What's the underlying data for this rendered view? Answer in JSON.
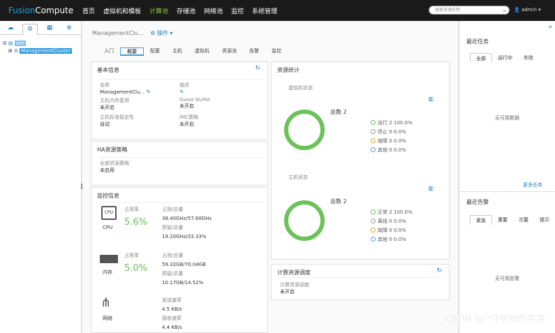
{
  "header": {
    "brand_prefix": "Fusion",
    "brand_suffix": "Compute",
    "nav": [
      "首页",
      "虚拟机和模板",
      "计算池",
      "存储池",
      "网络池",
      "监控",
      "系统管理"
    ],
    "active_nav_index": 2,
    "search_placeholder": "搜索资源名称",
    "user": "admin"
  },
  "left": {
    "tree": [
      {
        "label": "site",
        "level": 0
      },
      {
        "label": "ManagementCluster",
        "level": 1,
        "selected": true
      }
    ]
  },
  "main": {
    "breadcrumb": "ManagementClu...",
    "operation": "操作",
    "tabs": [
      "入门",
      "概要",
      "配置",
      "主机",
      "虚拟机",
      "资源池",
      "告警",
      "监控"
    ],
    "active_tab_index": 1,
    "basic": {
      "title": "基本信息",
      "fields": [
        {
          "k": "名称",
          "v": "ManagementClu..."
        },
        {
          "k": "描述",
          "v": ""
        },
        {
          "k": "主机内存复用",
          "v": "未开启"
        },
        {
          "k": "Guest NUMA",
          "v": "未开启"
        },
        {
          "k": "主机标准稳定性",
          "v": "自动"
        },
        {
          "k": "IMC策略",
          "v": "未开启"
        }
      ]
    },
    "ha": {
      "title": "HA资源策略",
      "k": "全部资源策略",
      "v": "未启用"
    },
    "monitor": {
      "title": "监控信息",
      "cpu": {
        "name": "CPU",
        "rate_label": "占用率",
        "rate": "5.6%",
        "l1": "占用/总量",
        "v1": "38.40GHz/57.60GHz",
        "l2": "预留/总量",
        "v2": "19.20GHz/33.33%"
      },
      "mem": {
        "name": "内存",
        "rate_label": "占用率",
        "rate": "5.0%",
        "l1": "占用/总量",
        "v1": "59.32GB/70.04GB",
        "l2": "预留/总量",
        "v2": "10.17GB/14.52%"
      },
      "net": {
        "name": "网络",
        "l1": "发送速率",
        "v1": "4.5 KB/s",
        "l2": "接收速率",
        "v2": "4.4 KB/s"
      }
    },
    "resources": {
      "title": "资源统计",
      "vm": {
        "title": "虚拟机状态",
        "total": "总数 2",
        "items": [
          {
            "label": "运行 2 100.0%",
            "color": "#6ac259"
          },
          {
            "label": "停止 0 0.0%",
            "color": "#999999"
          },
          {
            "label": "故障 0 0.0%",
            "color": "#f0a030"
          },
          {
            "label": "其他 0 0.0%",
            "color": "#3fa9e0"
          }
        ]
      },
      "host": {
        "title": "主机状态",
        "total": "总数 2",
        "items": [
          {
            "label": "正常 2 100.0%",
            "color": "#6ac259"
          },
          {
            "label": "离线 0 0.0%",
            "color": "#999999"
          },
          {
            "label": "故障 0 0.0%",
            "color": "#f0a030"
          },
          {
            "label": "其他 0 0.0%",
            "color": "#3fa9e0"
          }
        ]
      }
    },
    "compute": {
      "title": "计算资源调度",
      "k": "计算资源调度",
      "v": "未开启"
    }
  },
  "right": {
    "tasks": {
      "title": "最近任务",
      "tabs": [
        "全部",
        "运行中",
        "失败"
      ],
      "empty": "无可用数据",
      "more": "更多任务"
    },
    "alarms": {
      "title": "最近告警",
      "tabs": [
        "紧急",
        "重要",
        "次要",
        "提示"
      ],
      "empty": "无可用告警"
    }
  },
  "watermark": "CSDN @/*守护她的笑容"
}
